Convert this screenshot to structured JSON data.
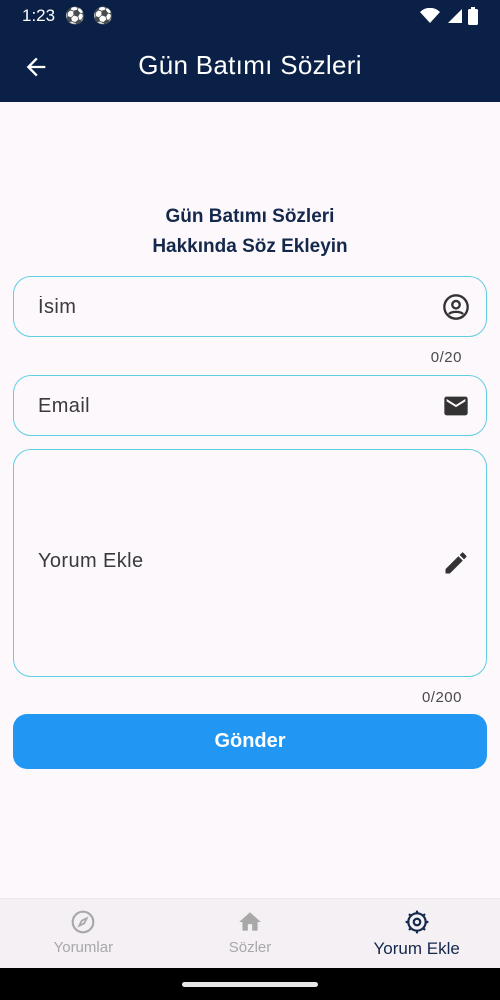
{
  "status_bar": {
    "time": "1:23"
  },
  "app_bar": {
    "title": "Gün Batımı Sözleri"
  },
  "form": {
    "heading_line1": "Gün Batımı Sözleri",
    "heading_line2": "Hakkında Söz Ekleyin",
    "name_placeholder": "İsim",
    "name_counter": "0/20",
    "email_placeholder": "Email",
    "comment_placeholder": "Yorum Ekle",
    "comment_counter": "0/200",
    "submit_label": "Gönder"
  },
  "bottom_nav": {
    "items": [
      {
        "label": "Yorumlar",
        "icon": "compass-icon",
        "active": false
      },
      {
        "label": "Sözler",
        "icon": "home-icon",
        "active": false
      },
      {
        "label": "Yorum Ekle",
        "icon": "gear-icon",
        "active": true
      }
    ]
  },
  "colors": {
    "app_bar": "#0a2046",
    "field_border": "#5fcfe0",
    "button": "#2196f3",
    "heading": "#14284b"
  }
}
